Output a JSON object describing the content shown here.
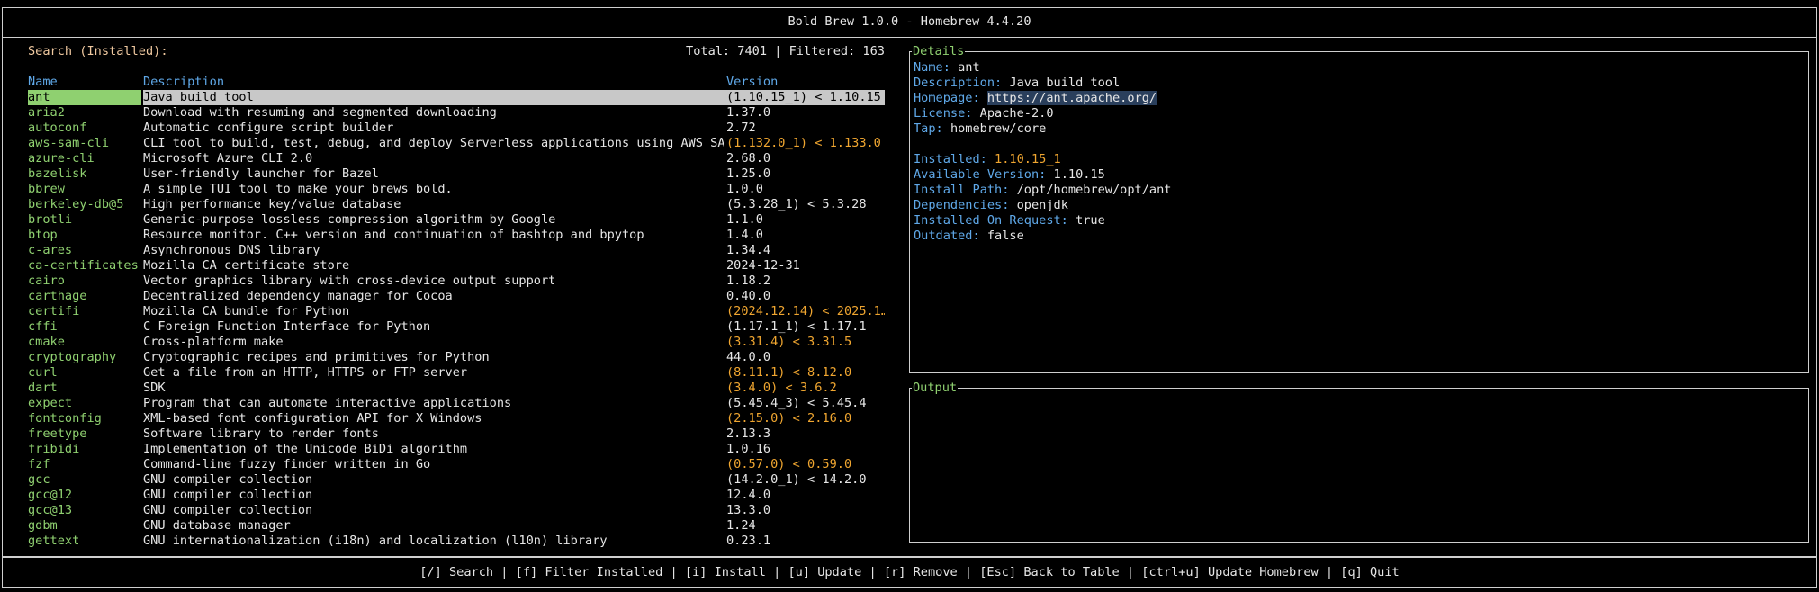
{
  "app": {
    "title": "Bold Brew 1.0.0 - Homebrew 4.4.20"
  },
  "search": {
    "label": "Search (Installed):",
    "totals": "Total: 7401 | Filtered: 163"
  },
  "table": {
    "headers": {
      "name": "Name",
      "description": "Description",
      "version": "Version"
    },
    "rows": [
      {
        "name": "ant",
        "description": "Java build tool",
        "version": "(1.10.15_1) < 1.10.15",
        "outdated": false,
        "selected": true
      },
      {
        "name": "aria2",
        "description": "Download with resuming and segmented downloading",
        "version": "1.37.0",
        "outdated": false
      },
      {
        "name": "autoconf",
        "description": "Automatic configure script builder",
        "version": "2.72",
        "outdated": false
      },
      {
        "name": "aws-sam-cli",
        "description": "CLI tool to build, test, debug, and deploy Serverless applications using AWS SAM",
        "version": "(1.132.0_1) < 1.133.0",
        "outdated": true
      },
      {
        "name": "azure-cli",
        "description": "Microsoft Azure CLI 2.0",
        "version": "2.68.0",
        "outdated": false
      },
      {
        "name": "bazelisk",
        "description": "User-friendly launcher for Bazel",
        "version": "1.25.0",
        "outdated": false
      },
      {
        "name": "bbrew",
        "description": "A simple TUI tool to make your brews bold.",
        "version": "1.0.0",
        "outdated": false
      },
      {
        "name": "berkeley-db@5",
        "description": "High performance key/value database",
        "version": "(5.3.28_1) < 5.3.28",
        "outdated": false
      },
      {
        "name": "brotli",
        "description": "Generic-purpose lossless compression algorithm by Google",
        "version": "1.1.0",
        "outdated": false
      },
      {
        "name": "btop",
        "description": "Resource monitor. C++ version and continuation of bashtop and bpytop",
        "version": "1.4.0",
        "outdated": false
      },
      {
        "name": "c-ares",
        "description": "Asynchronous DNS library",
        "version": "1.34.4",
        "outdated": false
      },
      {
        "name": "ca-certificates",
        "description": "Mozilla CA certificate store",
        "version": "2024-12-31",
        "outdated": false
      },
      {
        "name": "cairo",
        "description": "Vector graphics library with cross-device output support",
        "version": "1.18.2",
        "outdated": false
      },
      {
        "name": "carthage",
        "description": "Decentralized dependency manager for Cocoa",
        "version": "0.40.0",
        "outdated": false
      },
      {
        "name": "certifi",
        "description": "Mozilla CA bundle for Python",
        "version": "(2024.12.14) < 2025.1…",
        "outdated": true
      },
      {
        "name": "cffi",
        "description": "C Foreign Function Interface for Python",
        "version": "(1.17.1_1) < 1.17.1",
        "outdated": false
      },
      {
        "name": "cmake",
        "description": "Cross-platform make",
        "version": "(3.31.4) < 3.31.5",
        "outdated": true
      },
      {
        "name": "cryptography",
        "description": "Cryptographic recipes and primitives for Python",
        "version": "44.0.0",
        "outdated": false
      },
      {
        "name": "curl",
        "description": "Get a file from an HTTP, HTTPS or FTP server",
        "version": "(8.11.1) < 8.12.0",
        "outdated": true
      },
      {
        "name": "dart",
        "description": "SDK",
        "version": "(3.4.0) < 3.6.2",
        "outdated": true
      },
      {
        "name": "expect",
        "description": "Program that can automate interactive applications",
        "version": "(5.45.4_3) < 5.45.4",
        "outdated": false
      },
      {
        "name": "fontconfig",
        "description": "XML-based font configuration API for X Windows",
        "version": "(2.15.0) < 2.16.0",
        "outdated": true
      },
      {
        "name": "freetype",
        "description": "Software library to render fonts",
        "version": "2.13.3",
        "outdated": false
      },
      {
        "name": "fribidi",
        "description": "Implementation of the Unicode BiDi algorithm",
        "version": "1.0.16",
        "outdated": false
      },
      {
        "name": "fzf",
        "description": "Command-line fuzzy finder written in Go",
        "version": "(0.57.0) < 0.59.0",
        "outdated": true
      },
      {
        "name": "gcc",
        "description": "GNU compiler collection",
        "version": "(14.2.0_1) < 14.2.0",
        "outdated": false
      },
      {
        "name": "gcc@12",
        "description": "GNU compiler collection",
        "version": "12.4.0",
        "outdated": false
      },
      {
        "name": "gcc@13",
        "description": "GNU compiler collection",
        "version": "13.3.0",
        "outdated": false
      },
      {
        "name": "gdbm",
        "description": "GNU database manager",
        "version": "1.24",
        "outdated": false
      },
      {
        "name": "gettext",
        "description": "GNU internationalization (i18n) and localization (l10n) library",
        "version": "0.23.1",
        "outdated": false
      }
    ]
  },
  "details": {
    "title": "Details",
    "name_key": "Name:",
    "name": "ant",
    "desc_key": "Description:",
    "description": "Java build tool",
    "homepage_key": "Homepage:",
    "homepage": "https://ant.apache.org/",
    "license_key": "License:",
    "license": "Apache-2.0",
    "tap_key": "Tap:",
    "tap": "homebrew/core",
    "installed_key": "Installed:",
    "installed": "1.10.15_1",
    "available_key": "Available Version:",
    "available": "1.10.15",
    "path_key": "Install Path:",
    "path": "/opt/homebrew/opt/ant",
    "deps_key": "Dependencies:",
    "deps": "openjdk",
    "onreq_key": "Installed On Request:",
    "onreq": "true",
    "outdated_key": "Outdated:",
    "outdated": "false"
  },
  "output": {
    "title": "Output"
  },
  "footer": {
    "help": "[/] Search | [f] Filter Installed | [i] Install | [u] Update | [r] Remove | [Esc] Back to Table | [ctrl+u] Update Homebrew | [q] Quit"
  },
  "colors": {
    "name_green": "#8fd070",
    "header_blue": "#5fa8e8",
    "outdated_orange": "#f0a630",
    "label_peach": "#f0c9a0"
  }
}
